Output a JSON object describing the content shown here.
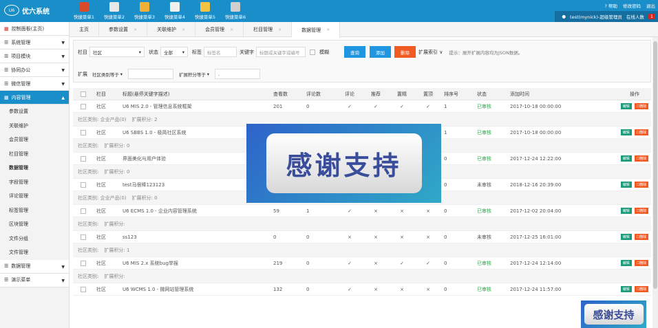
{
  "app": {
    "title": "优六系统",
    "logo_mark": "U6"
  },
  "quick_menu": [
    {
      "label": "快捷菜单1",
      "icon": "book-icon",
      "color": "#d94a2b"
    },
    {
      "label": "快捷菜单2",
      "icon": "id-card-icon",
      "color": "#e8e8e8"
    },
    {
      "label": "快捷菜单3",
      "icon": "shapes-icon",
      "color": "#f2b134"
    },
    {
      "label": "快捷菜单4",
      "icon": "printer-icon",
      "color": "#f0f0f0"
    },
    {
      "label": "快捷菜单5",
      "icon": "folder-icon",
      "color": "#f5c342"
    },
    {
      "label": "快捷菜单6",
      "icon": "tools-icon",
      "color": "#d0d0d0"
    }
  ],
  "topright": {
    "help": "帮助",
    "change_password": "修改密码",
    "logout": "退出"
  },
  "user": {
    "name": "test(mynick)-超级管理员",
    "online_label": "在线人数",
    "online_count": "1"
  },
  "sidebar": {
    "home": "控制面板(主页)",
    "groups_top": [
      "系统管理",
      "项目模块",
      "协同办公",
      "微信管理"
    ],
    "active_group": "内容管理",
    "sub_items": [
      "参数设置",
      "关联维护",
      "会员管理",
      "栏目管理",
      "数据管理",
      "字段管理",
      "评论管理",
      "标签管理",
      "区块管理",
      "文件分组",
      "文件管理"
    ],
    "active_sub": "数据管理",
    "groups_bottom": [
      "数据管理",
      "演示菜单"
    ]
  },
  "tabs": [
    {
      "label": "主页",
      "closable": false
    },
    {
      "label": "参数设置",
      "closable": true
    },
    {
      "label": "关联维护",
      "closable": true
    },
    {
      "label": "会员管理",
      "closable": true
    },
    {
      "label": "栏目管理",
      "closable": true
    },
    {
      "label": "数据管理",
      "closable": true
    }
  ],
  "filters": {
    "column_label": "栏目",
    "column_value": "社区",
    "status_label": "状态",
    "status_value": "全部",
    "tag_label": "标签",
    "tag_placeholder": "标签名",
    "keyword_label": "关键字",
    "keyword_placeholder": "标题或关键字或编号",
    "fuzzy_label": "模糊",
    "query_btn": "查询",
    "add_btn": "添加",
    "delete_btn": "删除",
    "index_label": "扩展索引",
    "tip": "提示：展开扩展内容均为JSON数据。",
    "ext_label": "扩展",
    "ext_field1": "社区类别等于",
    "ext_field2": "扩展积分等于",
    "ext_value2": "."
  },
  "table": {
    "headers": [
      "栏目",
      "标题(悬停关键字描述)",
      "查看数",
      "评论数",
      "评论",
      "推荐",
      "置精",
      "置顶",
      "排序号",
      "状态",
      "添加时间",
      "操作"
    ],
    "edit_label": "编辑",
    "delete_label": "删除",
    "rows": [
      {
        "column": "社区",
        "title": "U6 MIS 2.0 - 管理信息系统框架",
        "views": "201",
        "comments": "0",
        "f1": "✓",
        "f2": "✓",
        "f3": "✓",
        "f4": "✓",
        "sort": "1",
        "status": "已审核",
        "status_ok": true,
        "time": "2017-10-18 00:00:00",
        "ext": [
          "社区类别: 企业产品(0)",
          "扩展积分: 2"
        ]
      },
      {
        "column": "社区",
        "title": "U6 SBBS 1.0 - 极简社区系统",
        "views": "",
        "comments": "",
        "f1": "",
        "f2": "",
        "f3": "",
        "f4": "",
        "sort": "1",
        "status": "已审核",
        "status_ok": true,
        "time": "2017-10-18 00:00:00",
        "ext": [
          "社区类别:",
          "扩展积分: 0"
        ]
      },
      {
        "column": "社区",
        "title": "界面美化与用户体验",
        "views": "",
        "comments": "",
        "f1": "",
        "f2": "",
        "f3": "",
        "f4": "",
        "sort": "0",
        "status": "已审核",
        "status_ok": true,
        "time": "2017-12-24 12:22:00",
        "ext": [
          "社区类别:",
          "扩展积分: 0"
        ]
      },
      {
        "column": "社区",
        "title": "test马很棒123123",
        "views": "",
        "comments": "",
        "f1": "",
        "f2": "",
        "f3": "",
        "f4": "",
        "sort": "0",
        "status": "未审核",
        "status_ok": false,
        "time": "2018-12-16 20:39:00",
        "ext": [
          "社区类别: 企业产品(0)",
          "扩展积分: 0"
        ]
      },
      {
        "column": "社区",
        "title": "U6 ECMS 1.0 - 企业内容管理系统",
        "views": "59",
        "comments": "1",
        "f1": "✓",
        "f2": "×",
        "f3": "×",
        "f4": "×",
        "sort": "0",
        "status": "已审核",
        "status_ok": true,
        "time": "2017-12-02 20:04:00",
        "ext": [
          "社区类别:",
          "扩展积分:"
        ]
      },
      {
        "column": "社区",
        "title": "ss123",
        "views": "0",
        "comments": "0",
        "f1": "×",
        "f2": "×",
        "f3": "×",
        "f4": "×",
        "sort": "0",
        "status": "未审核",
        "status_ok": false,
        "time": "2017-12-25 16:01:00",
        "ext": [
          "社区类别:",
          "扩展积分: 1"
        ]
      },
      {
        "column": "社区",
        "title": "U6 MIS 2.x 系统bug举报",
        "views": "219",
        "comments": "0",
        "f1": "✓",
        "f2": "×",
        "f3": "✓",
        "f4": "✓",
        "sort": "0",
        "status": "已审核",
        "status_ok": true,
        "time": "2017-12-24 12:14:00",
        "ext": [
          "社区类别:",
          "扩展积分:"
        ]
      },
      {
        "column": "社区",
        "title": "U6 WCMS 1.0 - 微网站管理系统",
        "views": "132",
        "comments": "0",
        "f1": "✓",
        "f2": "×",
        "f3": "×",
        "f4": "×",
        "sort": "0",
        "status": "已审核",
        "status_ok": true,
        "time": "2017-12-24 11:57:00",
        "ext": []
      }
    ]
  },
  "promo": {
    "text": "感谢支持"
  }
}
